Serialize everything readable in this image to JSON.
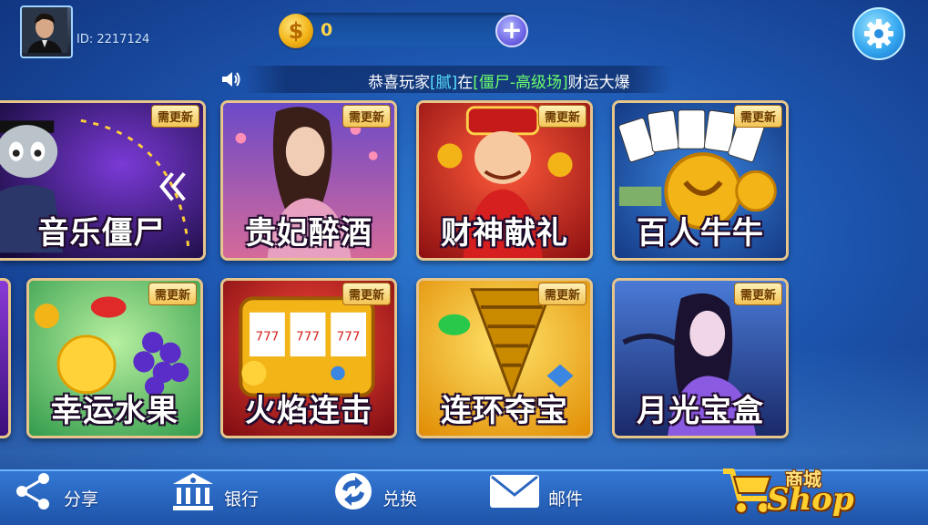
{
  "header": {
    "player_id": "ID: 2217124",
    "coins": "0",
    "add_coins_symbol": "+",
    "coin_symbol": "$"
  },
  "marquee": {
    "prefix": "恭喜玩家",
    "player": "[腻]",
    "mid": "在",
    "room": "[僵尸-高级场]",
    "suffix": "财运大爆"
  },
  "badge_label": "需更新",
  "games_row1": [
    {
      "title": "音乐僵尸",
      "icon": "zombie-music-icon"
    },
    {
      "title": "贵妃醉酒",
      "icon": "concubine-icon"
    },
    {
      "title": "财神献礼",
      "icon": "fortune-god-icon"
    },
    {
      "title": "百人牛牛",
      "icon": "poker-bull-icon"
    }
  ],
  "games_row2": [
    {
      "title": "幸运水果",
      "icon": "fruit-icon"
    },
    {
      "title": "火焰连击",
      "icon": "slot-machine-icon"
    },
    {
      "title": "连环夺宝",
      "icon": "drill-gem-icon"
    },
    {
      "title": "月光宝盒",
      "icon": "moonlight-lady-icon"
    }
  ],
  "bottom_nav": {
    "share": "分享",
    "bank": "银行",
    "exchange": "兑换",
    "mail": "邮件"
  },
  "shop": {
    "cn": "商城",
    "en": "Shop"
  },
  "colors": {
    "accent_blue": "#1d56b0",
    "gold": "#f2b417",
    "badge_bg": "#f3c455",
    "marquee_player": "#59e0ff",
    "marquee_room": "#6cff6c"
  }
}
